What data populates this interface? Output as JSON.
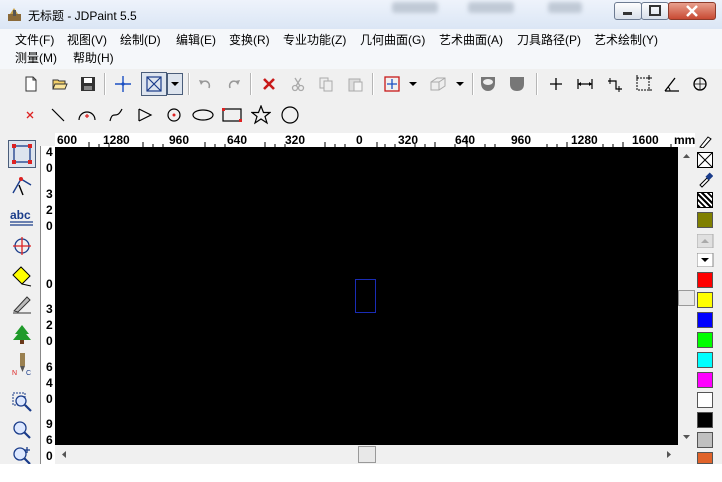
{
  "window": {
    "title": "无标题 - JDPaint 5.5"
  },
  "menu": {
    "row1": [
      "文件(F)",
      "视图(V)",
      "绘制(D)",
      "编辑(E)",
      "变换(R)",
      "专业功能(Z)",
      "几何曲面(G)",
      "艺术曲面(A)",
      "刀具路径(P)",
      "艺术绘制(Y)"
    ],
    "row2": [
      "测量(M)",
      "帮助(H)"
    ]
  },
  "toolbar_main": {
    "icons": [
      "new-file-icon",
      "open-folder-icon",
      "save-disk-icon",
      "snap-cross-icon",
      "select-box-icon",
      "dropdown-arrow-icon",
      "undo-icon",
      "redo-icon",
      "delete-x-icon",
      "copy-icon",
      "paste-icon",
      "cursor-arrow-icon",
      "dropdown-arrow-icon",
      "view-3d-box-icon",
      "dropdown-arrow-icon",
      "shade-view-icon",
      "tool-shape-icon",
      "point-icon",
      "dimension-horizontal-icon",
      "dimension-angled-icon",
      "dimension-box-icon",
      "angle-measure-icon",
      "rotate-view-icon"
    ]
  },
  "toolbar_draw": {
    "icons": [
      "point-x-icon",
      "line-icon",
      "arc-icon",
      "spline-icon",
      "polyline-icon",
      "circle-center-icon",
      "ellipse-icon",
      "rectangle-icon",
      "star-icon",
      "circle-icon"
    ]
  },
  "left_tools": [
    "select-node-icon",
    "pen-node-icon",
    "text-abc-icon",
    "transform-icon",
    "fill-icon",
    "knife-icon",
    "tree-icon",
    "nc-tool-icon",
    "zoom-window-icon",
    "zoom-icon",
    "zoom-plus-icon"
  ],
  "ruler_h": [
    "600",
    "1280",
    "960",
    "640",
    "320",
    "0",
    "320",
    "640",
    "960",
    "1280",
    "1600",
    "mm"
  ],
  "ruler_v": [
    "4",
    "0",
    "3",
    "2",
    "0",
    "0",
    "3",
    "2",
    "0",
    "6",
    "4",
    "0",
    "9",
    "6",
    "0"
  ],
  "palette": {
    "colors": [
      "#808000",
      "#ff0000",
      "#ffff00",
      "#0000ff",
      "#00ff00",
      "#00ffff",
      "#ff00ff",
      "#ffffff",
      "#000000",
      "#c0c0c0",
      "#e0632a"
    ]
  },
  "colors": {
    "canvas_bg": "#000000",
    "selection_rect": "#1a2cb5"
  }
}
